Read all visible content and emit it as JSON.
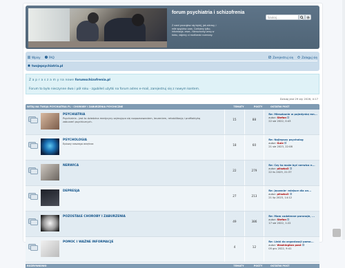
{
  "header": {
    "title": "forum psychiatria i schizofrenia",
    "description": "Z nami poczujesz się lepiej, jak zdrowy, i mile spędzisz czas. Czekamy tylko, informacje, rewe,. Nieruchomy umrę w łóżku, dajemy ci możliwość rozmowy.",
    "search_placeholder": "Szukaj...",
    "search_icon": "search-icon",
    "advanced_search_icon": "gear-icon"
  },
  "nav": {
    "quick_links": "Wpisy",
    "faq": "FAQ",
    "register": "Zarejestruj się",
    "login": "Zaloguj się",
    "breadcrumb": "twojepsychiatria.pl"
  },
  "announce": {
    "line1_spaced": "Z a p r a s z a m y  na nowe",
    "line1_site": "forumschizofrenia.pl",
    "line2": "Forum to było nieczynne dwa i pół roku - zgubiłeś użytki na forum adres e-mail, zarejestruj się z nowym kontem."
  },
  "date_text": "Dzisiaj jest 29 sty 2026, 4:17",
  "forum": {
    "col_headers": {
      "forum": "WITAJ NA TWOJA PSYCHIATRIA PL - CHOROBY I ZABURZENIA PSYCHICZNE",
      "topics": "TEMATY",
      "posts": "POSTY",
      "last": "OSTATNI POST"
    },
    "rows": [
      {
        "name": "PSYCHIATRIA",
        "desc": "Psychiatria - jest to dziedzina medycyny zajmująca się rozpoznawaniem, leczeniem, rehabilitacją i profilaktyką zaburzeń psychicznych.",
        "topics": "15",
        "posts": "88",
        "last_title": "Re: Mieszkanie w pojedynkę mn...",
        "last_by_prefix": "autor:",
        "last_by": "Stefan",
        "last_date": "22 sie 2022, 0:43"
      },
      {
        "name": "PSYCHOLOGIA",
        "desc": "Epiowy naszego wnętrza",
        "topics": "18",
        "posts": "60",
        "last_title": "Re: Najlepszy psycholog",
        "last_by_prefix": "autor:",
        "last_by": "Gule",
        "last_date": "21 sie 2023, 22:08"
      },
      {
        "name": "NERWICA",
        "desc": "",
        "topics": "22",
        "posts": "279",
        "last_title": "Re: Czy to może być nerwica n...",
        "last_by_prefix": "autor:",
        "last_by": "pliszka3",
        "last_date": "22 lis 2023, 21:37"
      },
      {
        "name": "DEPRESJA",
        "desc": "",
        "topics": "27",
        "posts": "213",
        "last_title": "Re: Jęczenie- miejsce dla on...",
        "last_by_prefix": "autor:",
        "last_by": "pliszka3",
        "last_date": "21 lip 2023, 14:12"
      },
      {
        "name": "POZOSTAŁE CHOROBY I ZABURZENIA",
        "desc": "",
        "topics": "49",
        "posts": "386",
        "last_title": "Re: Mam codzienne paranoje, ...",
        "last_by_prefix": "autor:",
        "last_by": "Stefan",
        "last_date": "17 sie 2022, 1:22"
      },
      {
        "name": "POMOC I WAŻNE INFORMACJE",
        "desc": "",
        "topics": "4",
        "posts": "12",
        "last_title": "Re: Linki do organizacji pomo...",
        "last_by_prefix": "autor:",
        "last_by": "Washington post",
        "last_date": "05 gru 2022, 9:41"
      }
    ],
    "footer": {
      "forum": "ROZRYWKOWO",
      "topics": "TEMATY",
      "posts": "POSTY",
      "last": "OSTATNI POST"
    }
  },
  "colors": {
    "header_bg": "#5e7488",
    "nav_bg": "#cadceb",
    "link": "#105289",
    "table_head": "#7f9bb3",
    "announce_bg": "#dff2f7"
  }
}
